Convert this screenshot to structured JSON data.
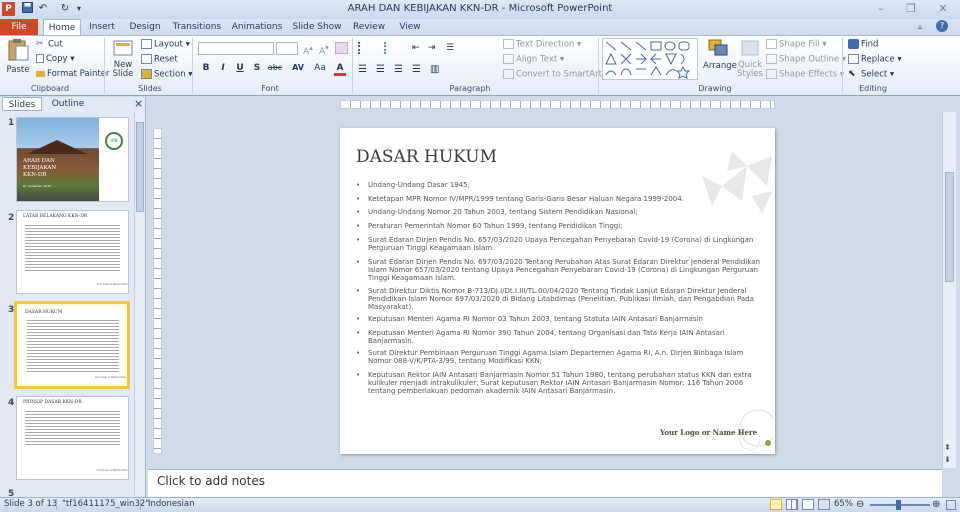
{
  "app": {
    "title": "ARAH DAN KEBIJAKAN KKN-DR  -  Microsoft PowerPoint",
    "app_icon": "P"
  },
  "quick_access": {
    "save_icon": "save-icon",
    "undo_icon": "undo-icon",
    "redo_icon": "redo-icon"
  },
  "window_controls": {
    "minimize": "–",
    "restore": "❐",
    "close": "✕"
  },
  "tabs": {
    "file": "File",
    "items": [
      "Home",
      "Insert",
      "Design",
      "Transitions",
      "Animations",
      "Slide Show",
      "Review",
      "View"
    ],
    "active": "Home"
  },
  "ribbon": {
    "clipboard": {
      "paste": "Paste",
      "cut": "Cut",
      "copy": "Copy",
      "format_painter": "Format Painter",
      "label": "Clipboard"
    },
    "slides": {
      "new_slide": "New Slide",
      "layout": "Layout",
      "reset": "Reset",
      "section": "Section",
      "label": "Slides"
    },
    "font": {
      "bold": "B",
      "italic": "I",
      "underline": "U",
      "shadow": "S",
      "strike": "abc",
      "spacing": "AV",
      "case": "Aa",
      "color": "A",
      "label": "Font"
    },
    "paragraph": {
      "text_direction": "Text Direction",
      "align_text": "Align Text",
      "convert_smartart": "Convert to SmartArt",
      "label": "Paragraph"
    },
    "drawing": {
      "arrange": "Arrange",
      "quick_styles": "Quick Styles",
      "shape_fill": "Shape Fill",
      "shape_outline": "Shape Outline",
      "shape_effects": "Shape Effects",
      "label": "Drawing"
    },
    "editing": {
      "find": "Find",
      "replace": "Replace",
      "select": "Select",
      "label": "Editing"
    }
  },
  "panel": {
    "tab_slides": "Slides",
    "tab_outline": "Outline",
    "close": "×"
  },
  "thumbnails": [
    {
      "num": "1",
      "title": "ARAH DAN KEBIJAKAN KKN-DR",
      "sub": "Dr. Sulaiman, M.Pd",
      "uin": "UIN"
    },
    {
      "num": "2",
      "title": "LATAR BELAKANG KKN-DR",
      "footer": "Your Logo or Name Here"
    },
    {
      "num": "3",
      "title": "DASAR HUKUM",
      "footer": "Your Logo or Name Here"
    },
    {
      "num": "4",
      "title": "PRINSIP DASAR KKN-DR",
      "footer": "Your Logo or Name Here"
    }
  ],
  "slide": {
    "title": "DASAR HUKUM",
    "bullets": [
      "Undang-Undang Dasar 1945;",
      "Ketetapan MPR Nomor IV/MPR/1999 tentang Garis-Garis Besar Haluan Negara 1999-2004.",
      "Undang-Undang Nomor 20 Tahun 2003, tentang Sistem Pendidikan Nasional;",
      "Peraturan Pemerintah Nomor 60 Tahun 1999, tentang Pendidikan Tinggi;",
      "Surat Edaran Dirjen Pendis No. 657/03/2020 Upaya Pencegahan Penyebaran Covid-19 (Corona) di Lingkungan Perguruan Tinggi Keagamaan Islam.",
      "Surat Edaran Dirjen Pendis No. 697/03/2020 Tentang Perubahan Atas Surat Edaran Direktur Jenderal Pendidikan Islam Nomor 657/03/2020 tentang Upaya Pencegahan Penyebaran Covid-19 (Corona) di Lingkungan Perguruan Tinggi Keagamaan Islam.",
      "Surat Direktur Diktis Nomor B-713/DJ.I/Dt.I.III/TL.00/04/2020 Tentang Tindak Lanjut Edaran Direktur Jenderal Pendidikan Islam Nomor 697/03/2020 di Bidang Litabdimas (Penelitian, Publikasi Ilmiah, dan Pengabdian Pada Masyarakat).",
      "Keputusan Menteri Agama RI Nomor 03 Tahun 2003, tentang Statuta IAIN Antasari Banjarmasin",
      "Keputusan Menteri Agama RI Nomor 390 Tahun 2004, tentang Organisasi dan Tata Kerja IAIN Antasari Banjarmasin.",
      "Surat Direktur Pembinaan Perguruan Tinggi Agama Islam Departemen Agama RI, A.n. Dirjen Binbaga Islam Nomor 088-V/K/PTA-3/99, tentang Modifikasi KKN;",
      "Keputusan Rektor IAIN Antasari Banjarmasin Nomor 51 Tahun 1980, tentang perubahan status KKN dan extra kulikuler menjadi intrakulikuler; Surat keputusan Rektor IAIN Antasari Banjarmasin Nomor: 116 Tahun 2006 tentang pemberlakuan pedoman akademik IAIN Antasari Banjarmasin."
    ],
    "logo_text": "Your Logo or Name Here"
  },
  "notes": {
    "placeholder": "Click to add notes"
  },
  "status": {
    "slide_info": "Slide 3 of 13",
    "theme": "\"tf16411175_win32\"",
    "language": "Indonesian",
    "zoom": "65%"
  },
  "colors": {
    "accent": "#d24726",
    "ribbon_bg": "#ffffff",
    "background": "#cfdbeb",
    "selection": "#f5c542"
  }
}
